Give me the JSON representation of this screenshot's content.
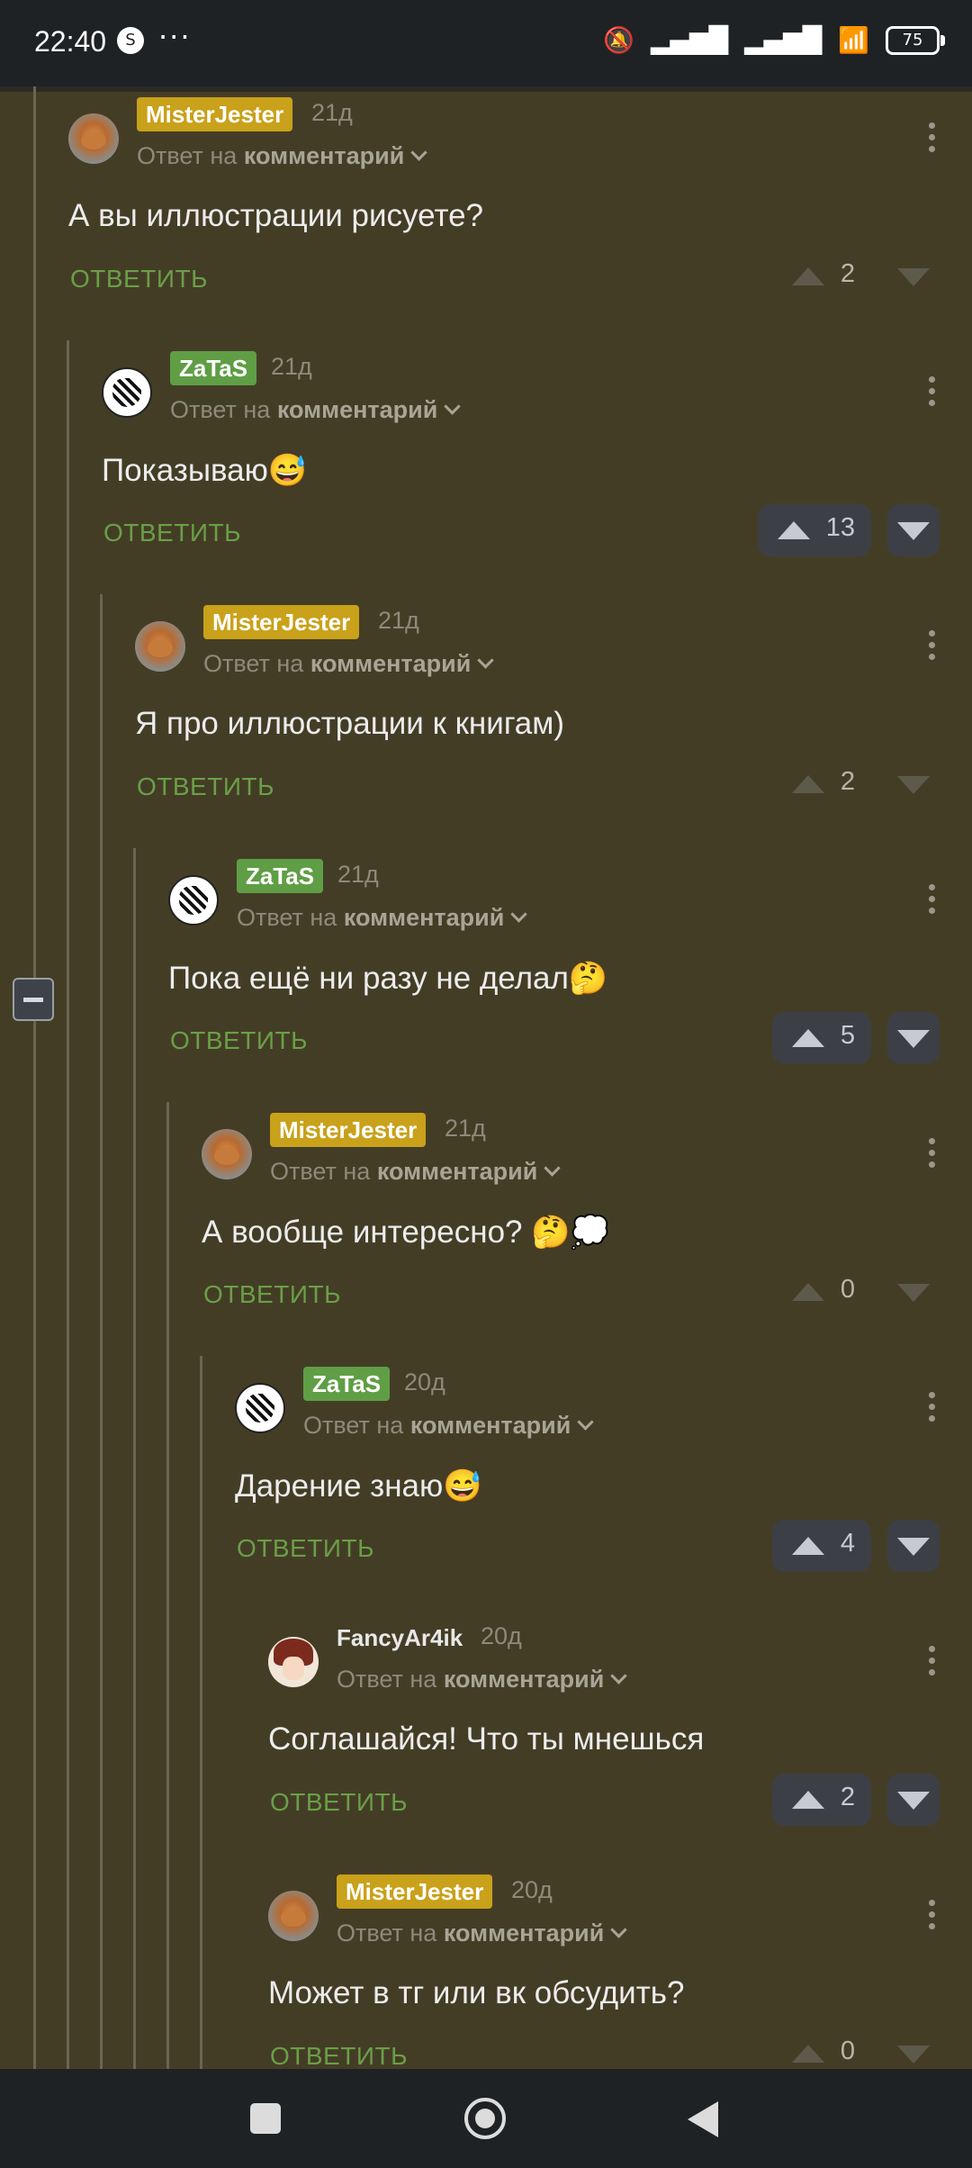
{
  "status_bar": {
    "time": "22:40",
    "battery": "75",
    "notification_icons": [
      "steam-icon",
      "more-dots"
    ],
    "system_icons": [
      "mute-icon",
      "signal-icon",
      "signal-icon",
      "wifi-icon",
      "battery-icon"
    ],
    "dots": "···"
  },
  "reply_label": "ОТВЕТИТЬ",
  "reply_prefix": "Ответ на",
  "reply_target": "комментарий",
  "comments": [
    {
      "author": "MisterJester",
      "badge": "gold",
      "avatar": "fox-avatar",
      "time": "21д",
      "text": "А вы иллюстрации рисуете?",
      "votes": "2",
      "voted": false
    },
    {
      "author": "ZaTaS",
      "badge": "green",
      "avatar": "bw-avatar",
      "time": "21д",
      "text": "Показываю😅",
      "votes": "13",
      "voted": true
    },
    {
      "author": "MisterJester",
      "badge": "gold",
      "avatar": "fox-avatar",
      "time": "21д",
      "text": "Я про иллюстрации к книгам)",
      "votes": "2",
      "voted": false
    },
    {
      "author": "ZaTaS",
      "badge": "green",
      "avatar": "bw-avatar",
      "time": "21д",
      "text": "Пока ещё ни разу не делал🤔",
      "votes": "5",
      "voted": true
    },
    {
      "author": "MisterJester",
      "badge": "gold",
      "avatar": "fox-avatar",
      "time": "21д",
      "text": "А вообще интересно? 🤔💭",
      "votes": "0",
      "voted": false
    },
    {
      "author": "ZaTaS",
      "badge": "green",
      "avatar": "bw-avatar",
      "time": "20д",
      "text": "Дарение знаю😅",
      "votes": "4",
      "voted": true
    },
    {
      "author": "FancyAr4ik",
      "badge": "plain",
      "avatar": "girl-avatar",
      "time": "20д",
      "text": "Соглашайся! Что ты мнешься",
      "votes": "2",
      "voted": true
    },
    {
      "author": "MisterJester",
      "badge": "gold",
      "avatar": "fox-avatar",
      "time": "20д",
      "text": "Может в тг или вк обсудить?",
      "votes": "0",
      "voted": false
    }
  ]
}
